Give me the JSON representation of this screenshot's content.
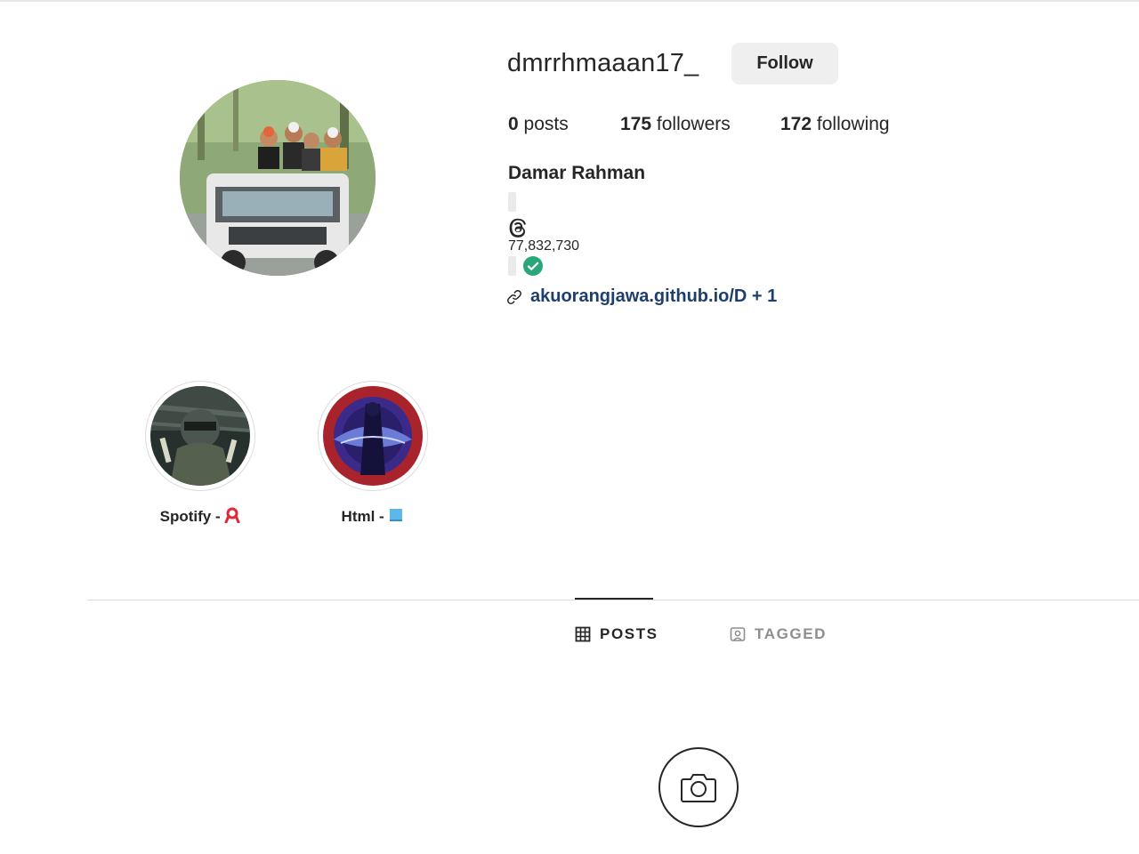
{
  "profile": {
    "username": "dmrrhmaaan17_",
    "follow_label": "Follow",
    "posts_count": "0",
    "posts_label": "posts",
    "followers_count": "175",
    "followers_label": "followers",
    "following_count": "172",
    "following_label": "following",
    "full_name": "Damar Rahman",
    "threads_count": "77,832,730",
    "link_text": "akuorangjawa.github.io/D + 1",
    "avatar_icon": "profile-photo-jeep"
  },
  "highlights": [
    {
      "label": "Spotify -",
      "emoji_icon": "red-ribbon-icon"
    },
    {
      "label": "Html -",
      "emoji_icon": "blue-square-icon"
    }
  ],
  "tabs": {
    "posts_label": "POSTS",
    "tagged_label": "TAGGED"
  },
  "colors": {
    "link": "#1e3f6c",
    "verified": "#2aa67a",
    "follow_bg": "#efefef",
    "tab_inactive": "#8e8e8e"
  }
}
